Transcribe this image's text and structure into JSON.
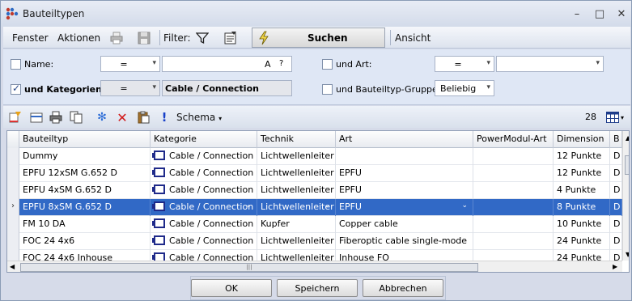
{
  "window": {
    "title": "Bauteiltypen",
    "minimize": "–",
    "maximize": "□",
    "close": "✕"
  },
  "menubar": {
    "fenster": "Fenster",
    "aktionen": "Aktionen",
    "filter_label": "Filter:",
    "suchen": "Suchen",
    "ansicht": "Ansicht",
    "icons": [
      "print-icon",
      "save-icon",
      "filter-icon",
      "filter-properties-icon",
      "lightning-icon"
    ]
  },
  "filter": {
    "name_label": "Name:",
    "name_operator": "=",
    "name_value": "",
    "name_case_glyph": "A",
    "name_help_glyph": "?",
    "art_label": "und Art:",
    "art_operator": "=",
    "art_value": "",
    "kat_label": "und Kategorien:",
    "kat_operator": "=",
    "kat_value": "Cable / Connection",
    "gruppen_label": "und Bauteiltyp-Gruppen:",
    "gruppen_value": "Beliebig",
    "name_checked": false,
    "art_checked": false,
    "kat_checked": true,
    "gruppen_checked": false
  },
  "grid_toolbar": {
    "schema": "Schema",
    "count": "28"
  },
  "grid": {
    "columns": [
      "Bauteiltyp",
      "Kategorie",
      "Technik",
      "Art",
      "PowerModul-Art",
      "Dimension",
      "B"
    ],
    "rows": [
      {
        "bauteiltyp": "Dummy",
        "kategorie": "Cable / Connection",
        "technik": "Lichtwellenleiter",
        "art": "",
        "power": "",
        "dimension": "12 Punkte",
        "b": "D"
      },
      {
        "bauteiltyp": "EPFU 12xSM G.652 D",
        "kategorie": "Cable / Connection",
        "technik": "Lichtwellenleiter",
        "art": "EPFU",
        "power": "",
        "dimension": "12 Punkte",
        "b": "D"
      },
      {
        "bauteiltyp": "EPFU 4xSM G.652 D",
        "kategorie": "Cable / Connection",
        "technik": "Lichtwellenleiter",
        "art": "EPFU",
        "power": "",
        "dimension": "4 Punkte",
        "b": "D"
      },
      {
        "bauteiltyp": "EPFU 8xSM G.652 D",
        "kategorie": "Cable / Connection",
        "technik": "Lichtwellenleiter",
        "art": "EPFU",
        "power": "",
        "dimension": "8 Punkte",
        "b": "D",
        "selected": true
      },
      {
        "bauteiltyp": "FM 10 DA",
        "kategorie": "Cable / Connection",
        "technik": "Kupfer",
        "art": "Copper cable",
        "power": "",
        "dimension": "10 Punkte",
        "b": "D"
      },
      {
        "bauteiltyp": "FOC 24 4x6",
        "kategorie": "Cable / Connection",
        "technik": "Lichtwellenleiter",
        "art": "Fiberoptic cable single-mode",
        "power": "",
        "dimension": "24 Punkte",
        "b": "D"
      },
      {
        "bauteiltyp": "FOC 24 4x6 Inhouse",
        "kategorie": "Cable / Connection",
        "technik": "Lichtwellenleiter",
        "art": "Inhouse FO",
        "power": "",
        "dimension": "24 Punkte",
        "b": "D"
      }
    ],
    "row_indicator": "›",
    "hscroll_grip": "|||"
  },
  "buttons": {
    "ok": "OK",
    "speichern": "Speichern",
    "abbrechen": "Abbrechen"
  }
}
